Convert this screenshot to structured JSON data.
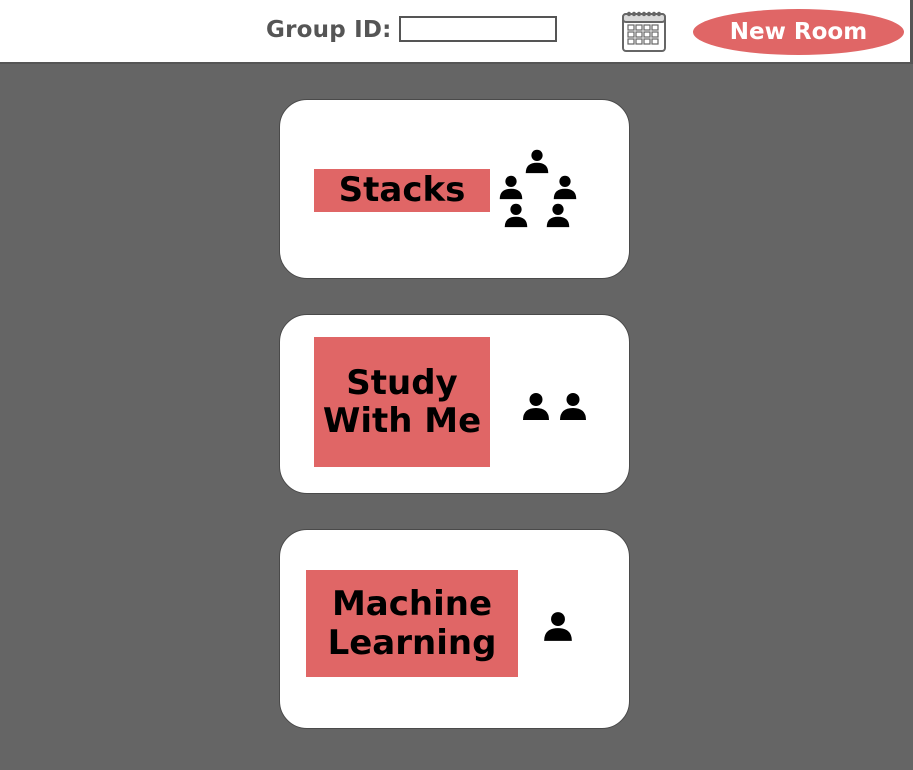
{
  "header": {
    "group_label": "Group ID:",
    "group_input_value": "",
    "group_input_placeholder": "",
    "calendar_icon": "calendar-icon",
    "new_room_label": "New Room",
    "accent_color": "#e06666"
  },
  "rooms": [
    {
      "name": "Stacks",
      "member_count": 5,
      "icon": "people-group-icon"
    },
    {
      "name": "Study With Me",
      "member_count": 2,
      "icon": "people-pair-icon"
    },
    {
      "name": "Machine Learning",
      "member_count": 1,
      "icon": "person-icon"
    }
  ]
}
